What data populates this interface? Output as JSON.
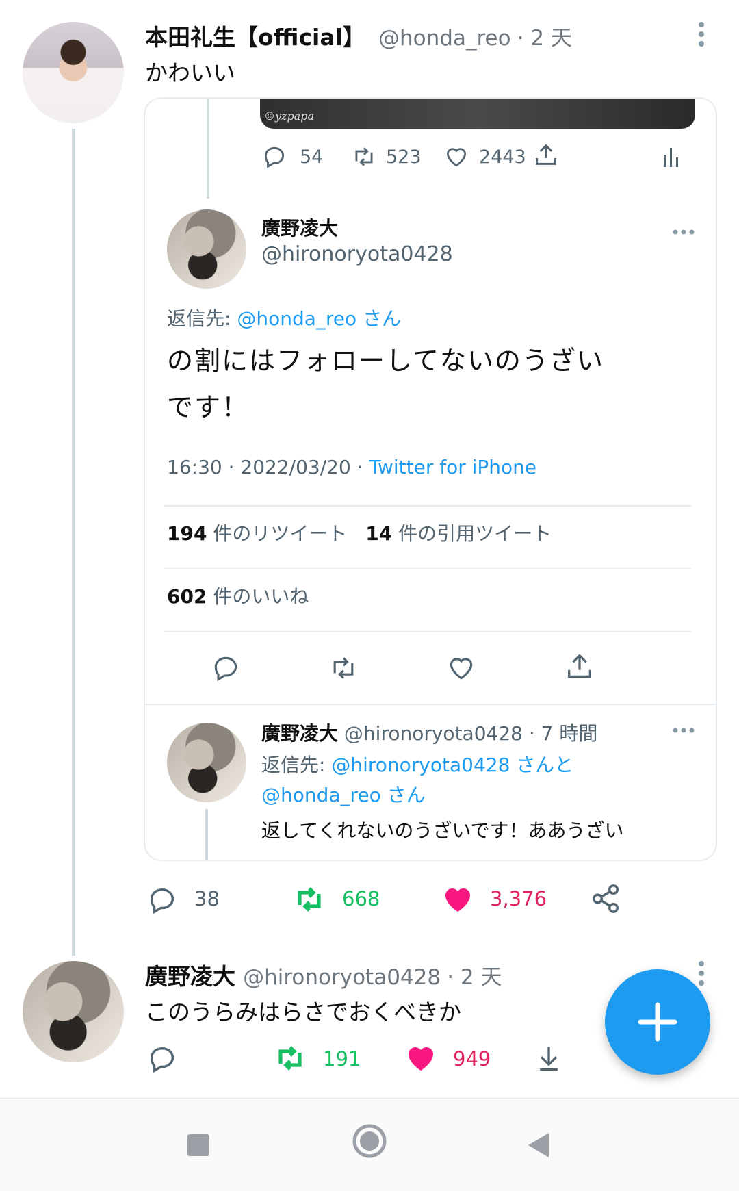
{
  "tweet1": {
    "name": "本田礼生【official】",
    "handle": "@honda_reo",
    "time": "· 2 天",
    "text": "かわいい",
    "stats": {
      "replies": "38",
      "retweets": "668",
      "likes": "3,376"
    }
  },
  "embed": {
    "image_watermark": "©yzpapa",
    "top_stats": {
      "replies": "54",
      "retweets": "523",
      "likes": "2443"
    },
    "main": {
      "name": "廣野凌大",
      "handle": "@hironoryota0428",
      "reply_prefix": "返信先:",
      "reply_to": "@honda_reo",
      "reply_suffix": "さん",
      "text_line1": "の割にはフォローしてないのうざい",
      "text_line2": "です！",
      "time": "16:30 · 2022/03/20 ·",
      "source": "Twitter for iPhone",
      "retweet_count": "194",
      "retweet_label": "件のリツイート",
      "quote_count": "14",
      "quote_label": "件の引用ツイート",
      "like_count": "602",
      "like_label": "件のいいね"
    },
    "reply": {
      "name": "廣野凌大",
      "handle": "@hironoryota0428",
      "time": "· 7 時間",
      "reply_prefix": "返信先:",
      "reply_to1": "@hironoryota0428",
      "reply_mid": "さんと",
      "reply_to2": "@honda_reo",
      "reply_suffix": "さん",
      "text": "返してくれないのうざいです！ああうざい"
    }
  },
  "tweet2": {
    "name": "廣野凌大",
    "handle": "@hironoryota0428",
    "time": "· 2 天",
    "text": "このうらみはらさでおくべきか",
    "stats": {
      "retweets": "191",
      "likes": "949"
    }
  },
  "colors": {
    "accent": "#1d9bf0",
    "retweet": "#17bf63",
    "like": "#e0245e"
  }
}
